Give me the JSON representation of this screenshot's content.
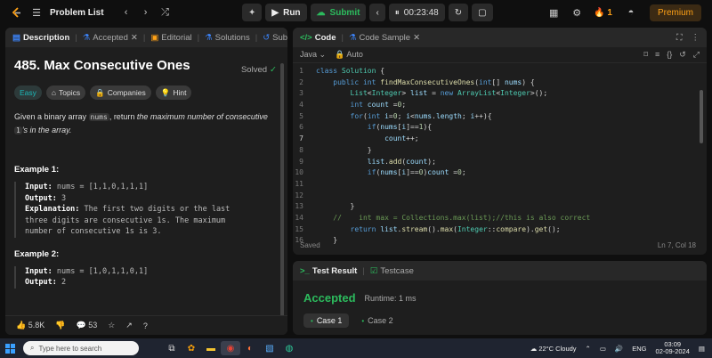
{
  "topbar": {
    "title": "Problem List",
    "run_label": "Run",
    "submit_label": "Submit",
    "timer": "00:23:48",
    "streak": "1",
    "premium_label": "Premium"
  },
  "left_tabs": [
    "Description",
    "Accepted",
    "Editorial",
    "Solutions",
    "Subm"
  ],
  "problem": {
    "title": "485. Max Consecutive Ones",
    "status": "Solved",
    "badges": [
      "Easy",
      "Topics",
      "Companies",
      "Hint"
    ],
    "p1": "Given a binary array ",
    "p1_code": "nums",
    "p1_b": ", return ",
    "p1_i": "the maximum number of consecutive",
    "p2_code": "1",
    "p2_i": "'s in the array."
  },
  "example1": {
    "title": "Example 1:",
    "input_label": "Input:",
    "input": " nums = [1,1,0,1,1,1]",
    "output_label": "Output:",
    "output": " 3",
    "expl_label": "Explanation:",
    "expl1": " The first two digits or the last",
    "expl2": "three digits are consecutive 1s. The maximum",
    "expl3": "number of consecutive 1s is 3."
  },
  "example2": {
    "title": "Example 2:",
    "input_label": "Input:",
    "input": " nums = [1,0,1,1,0,1]",
    "output_label": "Output:",
    "output": " 2"
  },
  "left_bottom": {
    "likes": "5.8K",
    "comments": "53"
  },
  "code_tabs": {
    "code": "Code",
    "sample": "Code Sample"
  },
  "code_sub": {
    "language": "Java",
    "mode": "Auto"
  },
  "code_status": {
    "saved": "Saved",
    "cursor": "Ln 7, Col 18"
  },
  "result_tabs": {
    "result": "Test Result",
    "testcase": "Testcase"
  },
  "result": {
    "status": "Accepted",
    "runtime": "Runtime: 1 ms",
    "cases": [
      "Case 1",
      "Case 2"
    ]
  },
  "taskbar": {
    "search": "Type here to search",
    "weather": "22°C  Cloudy",
    "lang": "ENG",
    "time": "03:09",
    "date": "02-09-2024"
  }
}
